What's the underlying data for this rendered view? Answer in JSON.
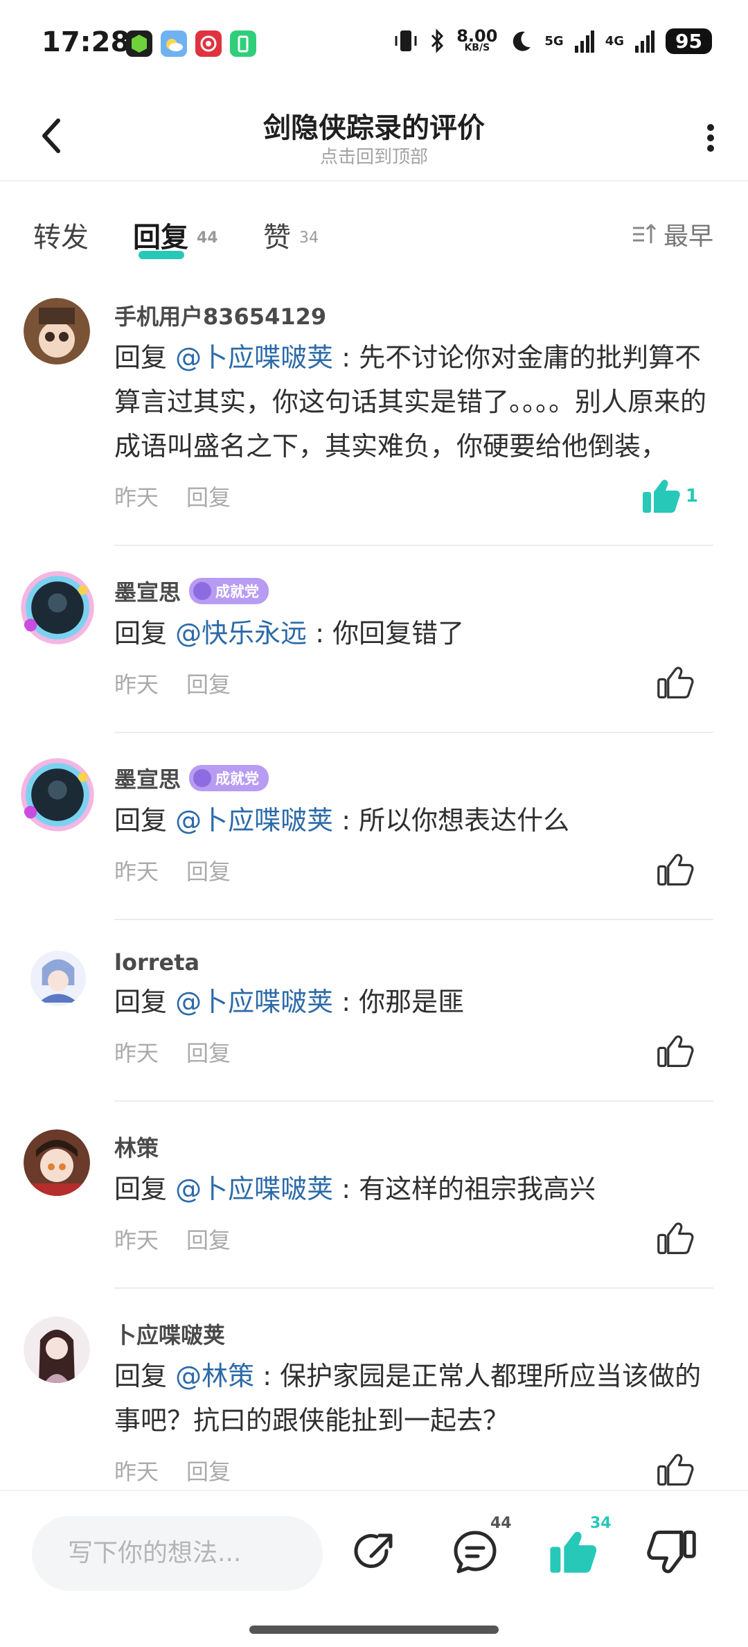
{
  "status_bar": {
    "time": "17:28",
    "net_speed_value": "8.00",
    "net_speed_unit": "KB/S",
    "signal1": "5G",
    "signal2": "4G",
    "battery": "95"
  },
  "header": {
    "title": "剑隐侠踪录的评价",
    "subtitle": "点击回到顶部"
  },
  "tabs": [
    {
      "label": "转发",
      "count": ""
    },
    {
      "label": "回复",
      "count": "44"
    },
    {
      "label": "赞",
      "count": "34"
    }
  ],
  "sort_label": "最早",
  "comments": [
    {
      "username": "手机用户83654129",
      "badge": "",
      "reply_prefix": "回复 ",
      "mention": "@卜应喋啵荚",
      "text": " : 先不讨论你对金庸的批判算不算言过其实，你这句话其实是错了。。。。别人原来的成语叫盛名之下，其实难负，你硬要给他倒装，",
      "time": "昨天",
      "reply_label": "回复",
      "likes": "1"
    },
    {
      "username": "墨宣思",
      "badge": "成就党",
      "reply_prefix": "回复 ",
      "mention": "@快乐永远",
      "text": " : 你回复错了",
      "time": "昨天",
      "reply_label": "回复",
      "likes": ""
    },
    {
      "username": "墨宣思",
      "badge": "成就党",
      "reply_prefix": "回复 ",
      "mention": "@卜应喋啵荚",
      "text": " : 所以你想表达什么",
      "time": "昨天",
      "reply_label": "回复",
      "likes": ""
    },
    {
      "username": "lorreta",
      "badge": "",
      "reply_prefix": "回复 ",
      "mention": "@卜应喋啵荚",
      "text": " : 你那是匪",
      "time": "昨天",
      "reply_label": "回复",
      "likes": ""
    },
    {
      "username": "林策",
      "badge": "",
      "reply_prefix": "回复 ",
      "mention": "@卜应喋啵荚",
      "text": " : 有这样的祖宗我高兴",
      "time": "昨天",
      "reply_label": "回复",
      "likes": ""
    },
    {
      "username": "卜应喋啵荚",
      "badge": "",
      "reply_prefix": "回复 ",
      "mention": "@林策",
      "text": " : 保护家园是正常人都理所应当该做的事吧？抗曰的跟侠能扯到一起去？",
      "time": "昨天",
      "reply_label": "回复",
      "likes": ""
    }
  ],
  "bottom_bar": {
    "input_placeholder": "写下你的想法...",
    "comment_count": "44",
    "like_count": "34"
  },
  "colors": {
    "accent": "#27c8b8",
    "mention": "#2c6aa8",
    "badge": "#b89bf3"
  }
}
